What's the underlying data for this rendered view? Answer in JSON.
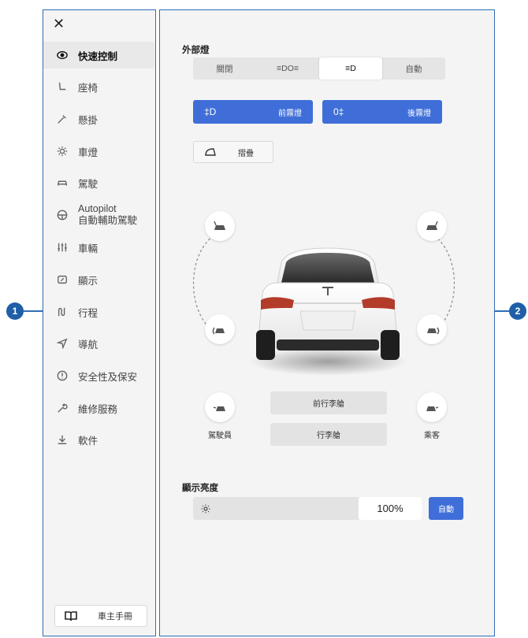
{
  "left_panel": {
    "close_glyph": "✕",
    "items": [
      {
        "label": "快速控制",
        "icon": "eye-icon",
        "active": true
      },
      {
        "label": "座椅",
        "icon": "seat-icon"
      },
      {
        "label": "懸掛",
        "icon": "wrench-icon"
      },
      {
        "label": "車燈",
        "icon": "light-bulb-icon"
      },
      {
        "label": "駕駛",
        "icon": "car-icon"
      },
      {
        "label": "Autopilot",
        "label2": "自動輔助駕駛",
        "icon": "steering-wheel-icon"
      },
      {
        "label": "車輛",
        "icon": "sliders-icon"
      },
      {
        "label": "顯示",
        "icon": "display-icon"
      },
      {
        "label": "行程",
        "icon": "trip-icon"
      },
      {
        "label": "導航",
        "icon": "navigation-icon"
      },
      {
        "label": "安全性及保安",
        "icon": "alert-icon"
      },
      {
        "label": "維修服務",
        "icon": "wrench-service-icon"
      },
      {
        "label": "軟件",
        "icon": "download-icon"
      }
    ],
    "manual_label": "車主手冊"
  },
  "right_panel": {
    "exterior_lights_title": "外部燈",
    "light_modes": [
      {
        "label": "關閉"
      },
      {
        "label": "≡DO≡"
      },
      {
        "label": "≡D"
      },
      {
        "label": "自動"
      }
    ],
    "selected_light_mode": 2,
    "front_fog": {
      "icon": "‡D",
      "label": "前霧燈"
    },
    "rear_fog": {
      "icon": "0‡",
      "label": "後霧燈"
    },
    "fold_label": "摺疊",
    "driver_label": "駕駛員",
    "passenger_label": "乘客",
    "front_trunk_label": "前行李艙",
    "trunk_label": "行李艙",
    "brightness_title": "顯示亮度",
    "brightness_value": "100%",
    "brightness_level": 1.0,
    "auto_label": "自動"
  },
  "callouts": {
    "left": "1",
    "right": "2"
  },
  "colors": {
    "accent": "#3f6ed8",
    "frame": "#2f6db6",
    "panel": "#f4f4f4"
  }
}
